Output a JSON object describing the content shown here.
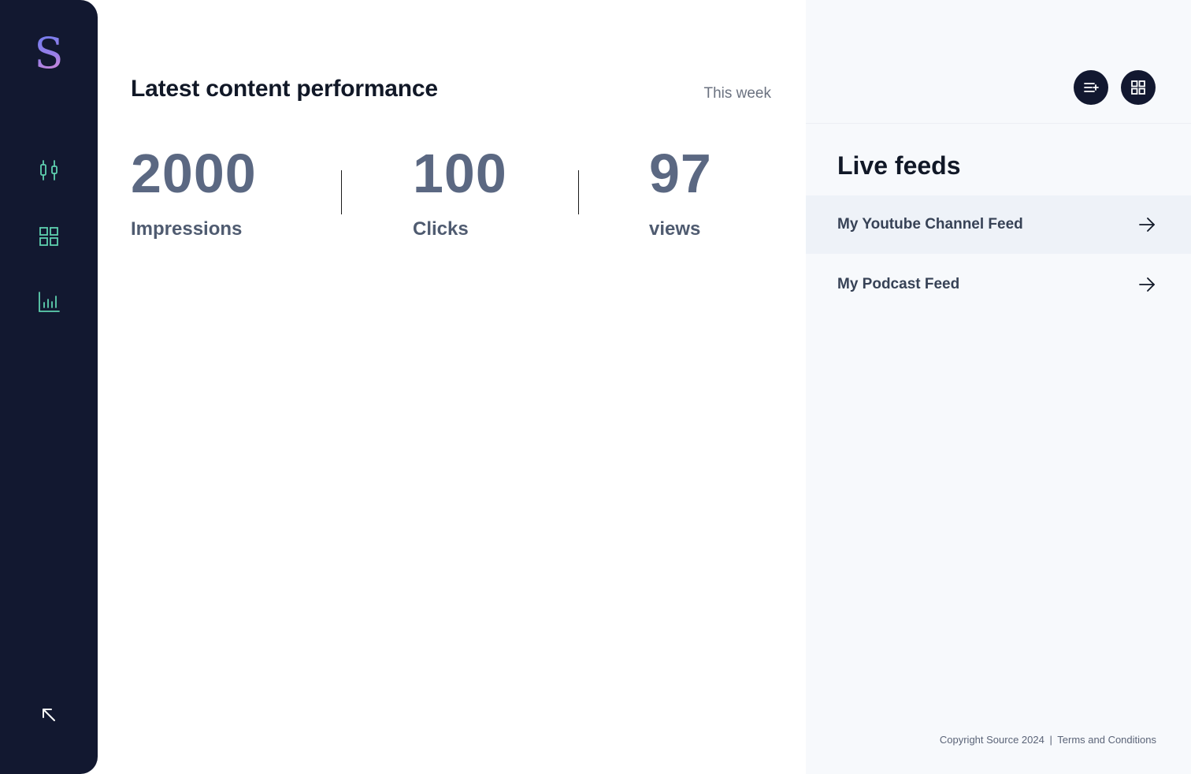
{
  "app": {
    "logo_letter": "S"
  },
  "sidebar": {
    "items": [
      {
        "name": "candlestick-icon"
      },
      {
        "name": "grid-icon"
      },
      {
        "name": "bar-chart-icon"
      }
    ],
    "collapse_icon": "arrow-up-left-icon",
    "icon_color": "#5ed1b0"
  },
  "main": {
    "title": "Latest content performance",
    "period": "This week",
    "stats": [
      {
        "value": "2000",
        "label": "Impressions"
      },
      {
        "value": "100",
        "label": "Clicks"
      },
      {
        "value": "97",
        "label": "views"
      }
    ]
  },
  "right_panel": {
    "actions": [
      {
        "name": "add-list-icon"
      },
      {
        "name": "grid-icon"
      }
    ],
    "feeds_title": "Live feeds",
    "feeds": [
      {
        "label": "My Youtube Channel Feed",
        "active": true
      },
      {
        "label": "My Podcast Feed",
        "active": false
      }
    ],
    "footer": {
      "copyright": "Copyright Source 2024",
      "separator": "|",
      "terms": "Terms and Conditions"
    }
  }
}
